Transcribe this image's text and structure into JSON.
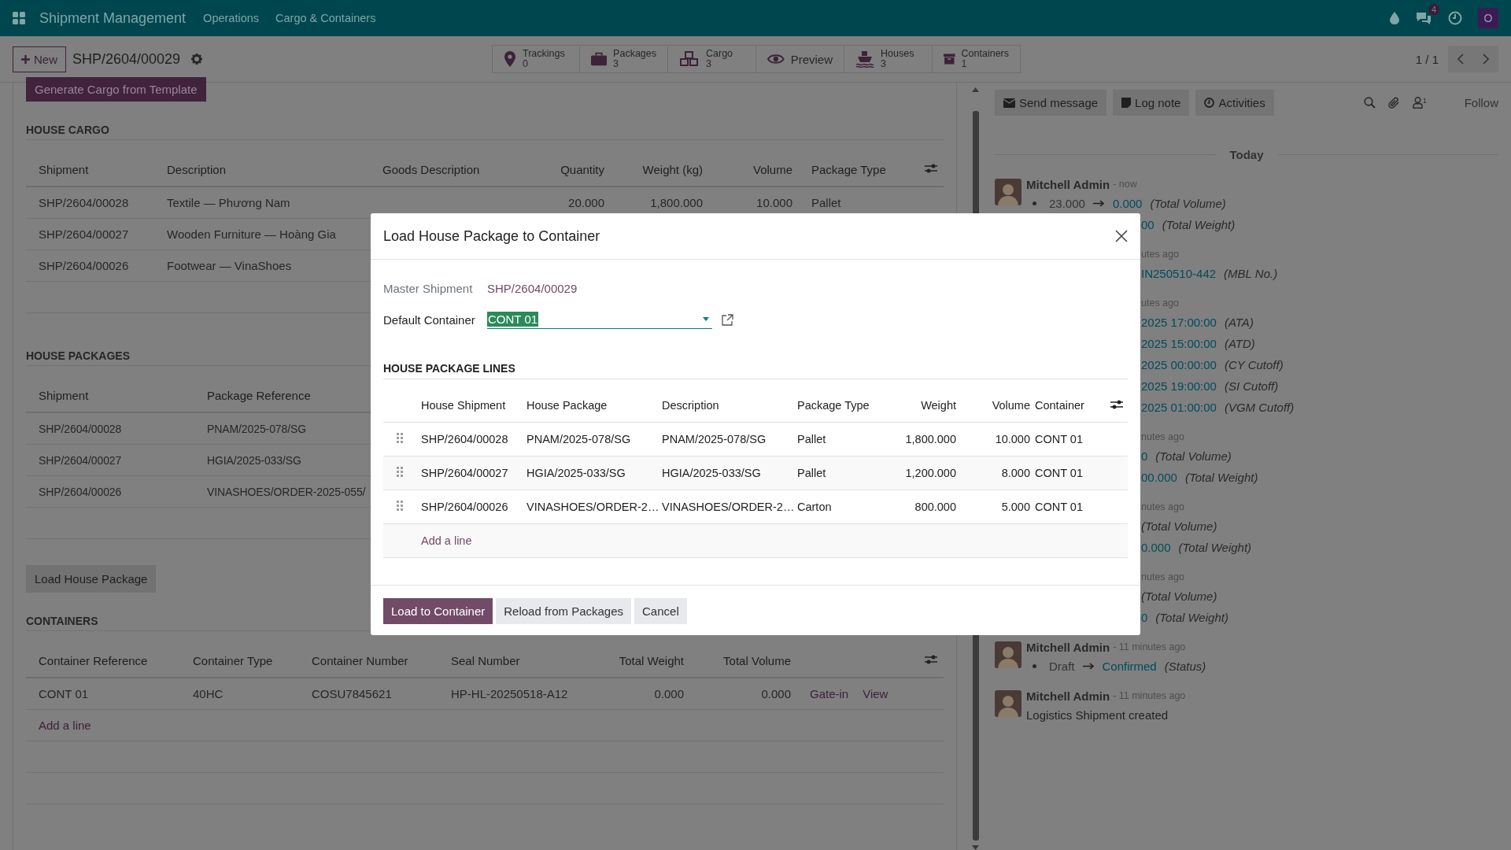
{
  "navbar": {
    "app_name": "Shipment Management",
    "menus": [
      "Operations",
      "Cargo & Containers"
    ],
    "message_count": "4",
    "user_initial": "O"
  },
  "control_panel": {
    "new_button": "New",
    "record_name": "SHP/2604/00029",
    "smart_buttons": [
      {
        "kind": "stat",
        "label": "Trackings",
        "value": "0"
      },
      {
        "kind": "stat",
        "label": "Packages",
        "value": "3"
      },
      {
        "kind": "stat",
        "label": "Cargo",
        "value": "3"
      },
      {
        "kind": "action",
        "label": "Preview"
      },
      {
        "kind": "stat",
        "label": "Houses",
        "value": "3"
      },
      {
        "kind": "stat",
        "label": "Containers",
        "value": "1"
      }
    ],
    "pager": "1 / 1"
  },
  "form": {
    "generate_button": "Generate Cargo from Template",
    "house_cargo": {
      "title": "HOUSE CARGO",
      "columns": [
        "Shipment",
        "Description",
        "Goods Description",
        "Quantity",
        "Weight (kg)",
        "Volume",
        "Package Type"
      ],
      "rows": [
        {
          "shipment": "SHP/2604/00028",
          "description": "Textile — Phương Nam",
          "quantity": "20.000",
          "weight": "1,800.000",
          "volume": "10.000",
          "package_type": "Pallet"
        },
        {
          "shipment": "SHP/2604/00027",
          "description": "Wooden Furniture — Hoàng Gia"
        },
        {
          "shipment": "SHP/2604/00026",
          "description": "Footwear — VinaShoes"
        }
      ]
    },
    "house_packages": {
      "title": "HOUSE PACKAGES",
      "columns": [
        "Shipment",
        "Package Reference"
      ],
      "rows": [
        {
          "shipment": "SHP/2604/00028",
          "reference": "PNAM/2025-078/SG"
        },
        {
          "shipment": "SHP/2604/00027",
          "reference": "HGIA/2025-033/SG"
        },
        {
          "shipment": "SHP/2604/00026",
          "reference": "VINASHOES/ORDER-2025-055/"
        }
      ]
    },
    "load_button": "Load House Package",
    "containers": {
      "title": "CONTAINERS",
      "columns": [
        "Container Reference",
        "Container Type",
        "Container Number",
        "Seal Number",
        "Total Weight",
        "Total Volume"
      ],
      "rows": [
        {
          "reference": "CONT 01",
          "type": "40HC",
          "number": "COSU7845621",
          "seal": "HP-HL-20250518-A12",
          "weight": "0.000",
          "volume": "0.000",
          "actions": [
            "Gate-in",
            "View"
          ]
        }
      ],
      "add_line": "Add a line"
    }
  },
  "chatter": {
    "buttons": [
      "Send message",
      "Log note",
      "Activities"
    ],
    "follower_count": "1",
    "follow": "Follow",
    "date_separator": "Today",
    "messages": [
      {
        "kind": "full",
        "author": "Mitchell Admin",
        "time": "- now",
        "lines": [
          {
            "kind": "change",
            "old": "23.000",
            "new": "0.000",
            "field": "(Total Volume)"
          },
          {
            "kind": "fragment",
            "new": "00",
            "field": "(Total Weight)"
          }
        ]
      },
      {
        "kind": "partial",
        "time": "utes ago",
        "lines": [
          {
            "kind": "fragment",
            "new": "IN250510-442",
            "field": "(MBL No.)"
          }
        ]
      },
      {
        "kind": "partial",
        "time": "utes ago",
        "lines": [
          {
            "kind": "fragment",
            "new": "2025 17:00:00",
            "field": "(ATA)"
          },
          {
            "kind": "fragment",
            "new": "2025 15:00:00",
            "field": "(ATD)"
          },
          {
            "kind": "fragment",
            "new": "2025 00:00:00",
            "field": "(CY Cutoff)"
          },
          {
            "kind": "fragment",
            "new": "2025 19:00:00",
            "field": "(SI Cutoff)"
          },
          {
            "kind": "fragment",
            "new": "2025 01:00:00",
            "field": "(VGM Cutoff)"
          }
        ]
      },
      {
        "kind": "partial",
        "time": "nutes ago",
        "lines": [
          {
            "kind": "fragment",
            "new": "0",
            "field": "(Total Volume)"
          },
          {
            "kind": "fragment",
            "new": "00.000",
            "field": "(Total Weight)"
          }
        ]
      },
      {
        "kind": "partial",
        "time": "nutes ago",
        "lines": [
          {
            "kind": "fragment",
            "field": "(Total Volume)"
          },
          {
            "kind": "fragment",
            "new": "0.000",
            "field": "(Total Weight)"
          }
        ]
      },
      {
        "kind": "partial",
        "time": "nutes ago",
        "lines": [
          {
            "kind": "fragment",
            "field": "(Total Volume)"
          },
          {
            "kind": "fragment",
            "new": "0",
            "field": "(Total Weight)"
          }
        ]
      },
      {
        "kind": "full",
        "author": "Mitchell Admin",
        "time": "- 11 minutes ago",
        "lines": [
          {
            "kind": "change",
            "old": "Draft",
            "new": "Confirmed",
            "field": "(Status)"
          }
        ]
      },
      {
        "kind": "full",
        "author": "Mitchell Admin",
        "time": "- 11 minutes ago",
        "lines": [
          {
            "kind": "text",
            "text": "Logistics Shipment created"
          }
        ]
      }
    ]
  },
  "dialog": {
    "title": "Load House Package to Container",
    "master_label": "Master Shipment",
    "master_value": "SHP/2604/00029",
    "container_label": "Default Container",
    "container_value": "CONT 01",
    "section_title": "HOUSE PACKAGE LINES",
    "columns": [
      "House Shipment",
      "House Package",
      "Description",
      "Package Type",
      "Weight",
      "Volume",
      "Container"
    ],
    "rows": [
      {
        "shipment": "SHP/2604/00028",
        "package": "PNAM/2025-078/SG",
        "description": "PNAM/2025-078/SG",
        "package_type": "Pallet",
        "weight": "1,800.000",
        "volume": "10.000",
        "container": "CONT 01"
      },
      {
        "shipment": "SHP/2604/00027",
        "package": "HGIA/2025-033/SG",
        "description": "HGIA/2025-033/SG",
        "package_type": "Pallet",
        "weight": "1,200.000",
        "volume": "8.000",
        "container": "CONT 01"
      },
      {
        "shipment": "SHP/2604/00026",
        "package": "VINASHOES/ORDER-2…",
        "description": "VINASHOES/ORDER-2…",
        "package_type": "Carton",
        "weight": "800.000",
        "volume": "5.000",
        "container": "CONT 01"
      }
    ],
    "add_line": "Add a line",
    "buttons": [
      {
        "kind": "primary",
        "label": "Load to Container"
      },
      {
        "kind": "secondary",
        "label": "Reload from Packages"
      },
      {
        "kind": "secondary",
        "label": "Cancel"
      }
    ]
  }
}
